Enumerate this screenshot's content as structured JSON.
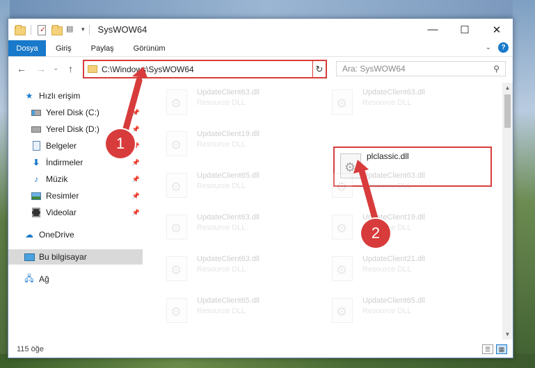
{
  "window": {
    "title": "SysWOW64",
    "minimize": "—",
    "maximize": "☐",
    "close": "✕"
  },
  "ribbon": {
    "tabs": [
      "Dosya",
      "Giriş",
      "Paylaş",
      "Görünüm"
    ]
  },
  "address": {
    "path": "C:\\Windows\\SysWOW64",
    "refresh": "↻"
  },
  "search": {
    "placeholder": "Ara: SysWOW64"
  },
  "nav": {
    "back": "←",
    "forward": "→",
    "recent": "⌄",
    "up": "↑",
    "items": [
      {
        "label": "Hızlı erişim",
        "icon": "star-icon"
      },
      {
        "label": "Yerel Disk (C:)",
        "icon": "drive-c-icon"
      },
      {
        "label": "Yerel Disk (D:)",
        "icon": "drive-d-icon"
      },
      {
        "label": "Belgeler",
        "icon": "documents-icon"
      },
      {
        "label": "İndirmeler",
        "icon": "downloads-icon"
      },
      {
        "label": "Müzik",
        "icon": "music-icon"
      },
      {
        "label": "Resimler",
        "icon": "pictures-icon"
      },
      {
        "label": "Videolar",
        "icon": "videos-icon"
      },
      {
        "label": "OneDrive",
        "icon": "onedrive-icon"
      },
      {
        "label": "Bu bilgisayar",
        "icon": "this-pc-icon"
      },
      {
        "label": "Ağ",
        "icon": "network-icon"
      }
    ]
  },
  "files": {
    "left": [
      {
        "name": "UpdateClient63.dll",
        "type": "Resource DLL"
      },
      {
        "name": "UpdateClient19.dll",
        "type": "Resource DLL"
      },
      {
        "name": "UpdateClient65.dll",
        "type": "Resource DLL"
      },
      {
        "name": "UpdateClient63.dll",
        "type": "Resource DLL"
      },
      {
        "name": "UpdateClient63.dll",
        "type": "Resource DLL"
      },
      {
        "name": "UpdateClient65.dll",
        "type": "Resource DLL"
      }
    ],
    "right": [
      {
        "name": "UpdateClient63.dll",
        "type": "Resource DLL"
      },
      {
        "name": "plclassic.dll",
        "type": ""
      },
      {
        "name": "UpdateClient63.dll",
        "type": "Resource DLL"
      },
      {
        "name": "UpdateClient19.dll",
        "type": "Resource DLL"
      },
      {
        "name": "UpdateClient21.dll",
        "type": "Resource DLL"
      },
      {
        "name": "UpdateClient65.dll",
        "type": "Resource DLL"
      }
    ]
  },
  "status": {
    "count": "115 öğe"
  },
  "callouts": [
    "1",
    "2"
  ],
  "colors": {
    "accent": "#1979ca",
    "highlight": "#d83b3b"
  }
}
